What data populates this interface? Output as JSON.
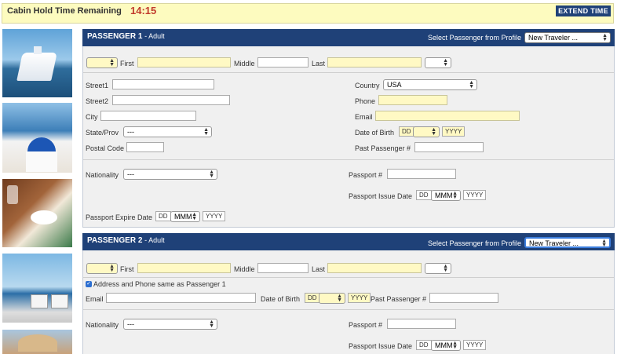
{
  "hold": {
    "label": "Cabin Hold Time Remaining",
    "time": "14:15",
    "extend": "EXTEND TIME"
  },
  "profile_label": "Select Passenger from Profile",
  "profile_value": "New Traveler ...",
  "fields": {
    "first": "First",
    "middle": "Middle",
    "last": "Last",
    "street1": "Street1",
    "street2": "Street2",
    "city": "City",
    "state": "State/Prov",
    "postal": "Postal Code",
    "country": "Country",
    "phone": "Phone",
    "email": "Email",
    "dob": "Date of Birth",
    "past": "Past Passenger #",
    "nationality": "Nationality",
    "passport": "Passport #",
    "issue": "Passport Issue Date",
    "expire": "Passport Expire Date"
  },
  "values": {
    "country": "USA",
    "state": "---",
    "nationality": "---"
  },
  "date_ph": {
    "dd": "DD",
    "mmm": "MMM",
    "yyyy": "YYYY"
  },
  "p1": {
    "title": "PASSENGER 1",
    "sub": "- Adult"
  },
  "p2": {
    "title": "PASSENGER 2",
    "sub": "- Adult",
    "same_address": "Address and Phone same as Passenger 1"
  }
}
